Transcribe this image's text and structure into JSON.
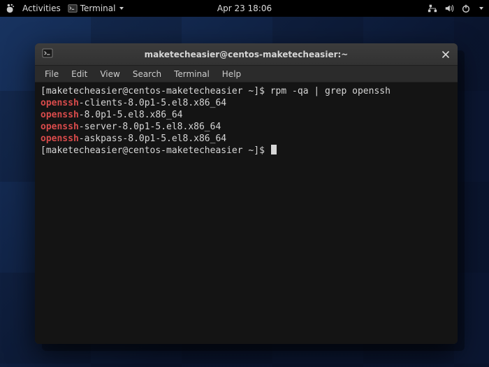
{
  "topbar": {
    "activities": "Activities",
    "app_name": "Terminal",
    "clock": "Apr 23  18:06"
  },
  "window": {
    "title": "maketecheasier@centos-maketecheasier:~"
  },
  "menubar": {
    "file": "File",
    "edit": "Edit",
    "view": "View",
    "search": "Search",
    "terminal": "Terminal",
    "help": "Help"
  },
  "terminal": {
    "prompt": "[maketecheasier@centos-maketecheasier ~]$ ",
    "command1": "rpm -qa | grep openssh",
    "lines": [
      {
        "hl": "openssh",
        "rest": "-clients-8.0p1-5.el8.x86_64"
      },
      {
        "hl": "openssh",
        "rest": "-8.0p1-5.el8.x86_64"
      },
      {
        "hl": "openssh",
        "rest": "-server-8.0p1-5.el8.x86_64"
      },
      {
        "hl": "openssh",
        "rest": "-askpass-8.0p1-5.el8.x86_64"
      }
    ]
  }
}
